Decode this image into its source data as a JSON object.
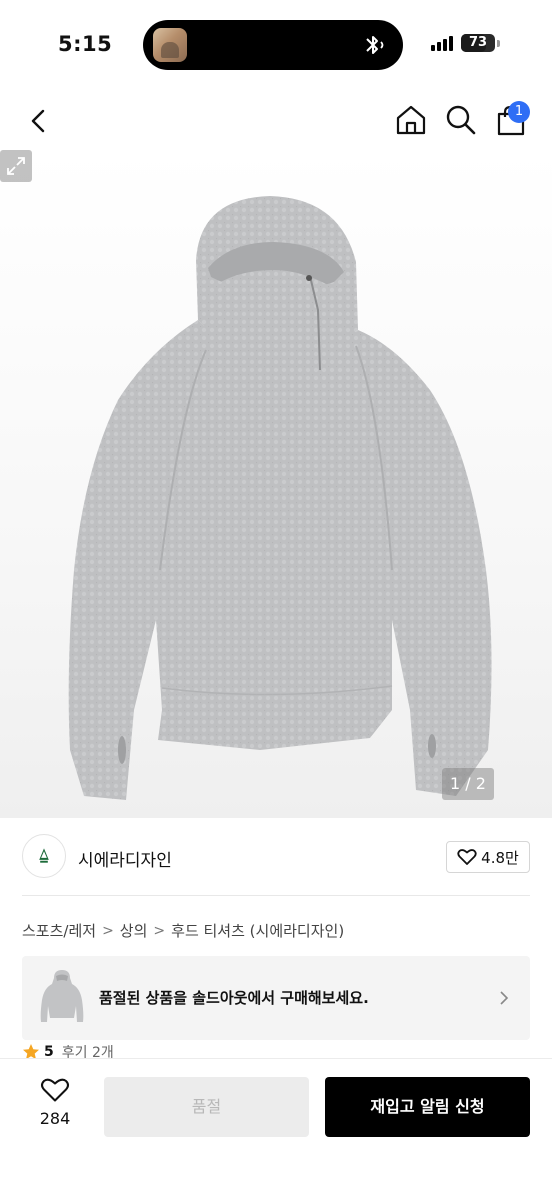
{
  "status_bar": {
    "time": "5:15",
    "battery": "73",
    "battery_level": 0.73
  },
  "nav": {
    "back_icon": "chevron-left-icon",
    "home_icon": "home-icon",
    "search_icon": "search-icon",
    "cart_icon": "shopping-bag-icon",
    "cart_badge": "1",
    "badge_color": "#2f6ef5"
  },
  "gallery": {
    "counter": "1 / 2",
    "expand_icon": "expand-icon"
  },
  "brand": {
    "name": "시에라디자인",
    "likes": "4.8만"
  },
  "breadcrumb": [
    {
      "label": "스포츠/레저"
    },
    {
      "label": "상의"
    },
    {
      "label": "후드 티셔츠 (시에라디자인)"
    }
  ],
  "soldout_banner": {
    "text": "품절된 상품을 솔드아웃에서 구매해보세요."
  },
  "rating": {
    "score": "5",
    "reviews": "후기 2개",
    "star_color": "#f5a623"
  },
  "bottom_bar": {
    "wish_count": "284",
    "soldout_label": "품절",
    "restock_label": "재입고 알림 신청"
  }
}
